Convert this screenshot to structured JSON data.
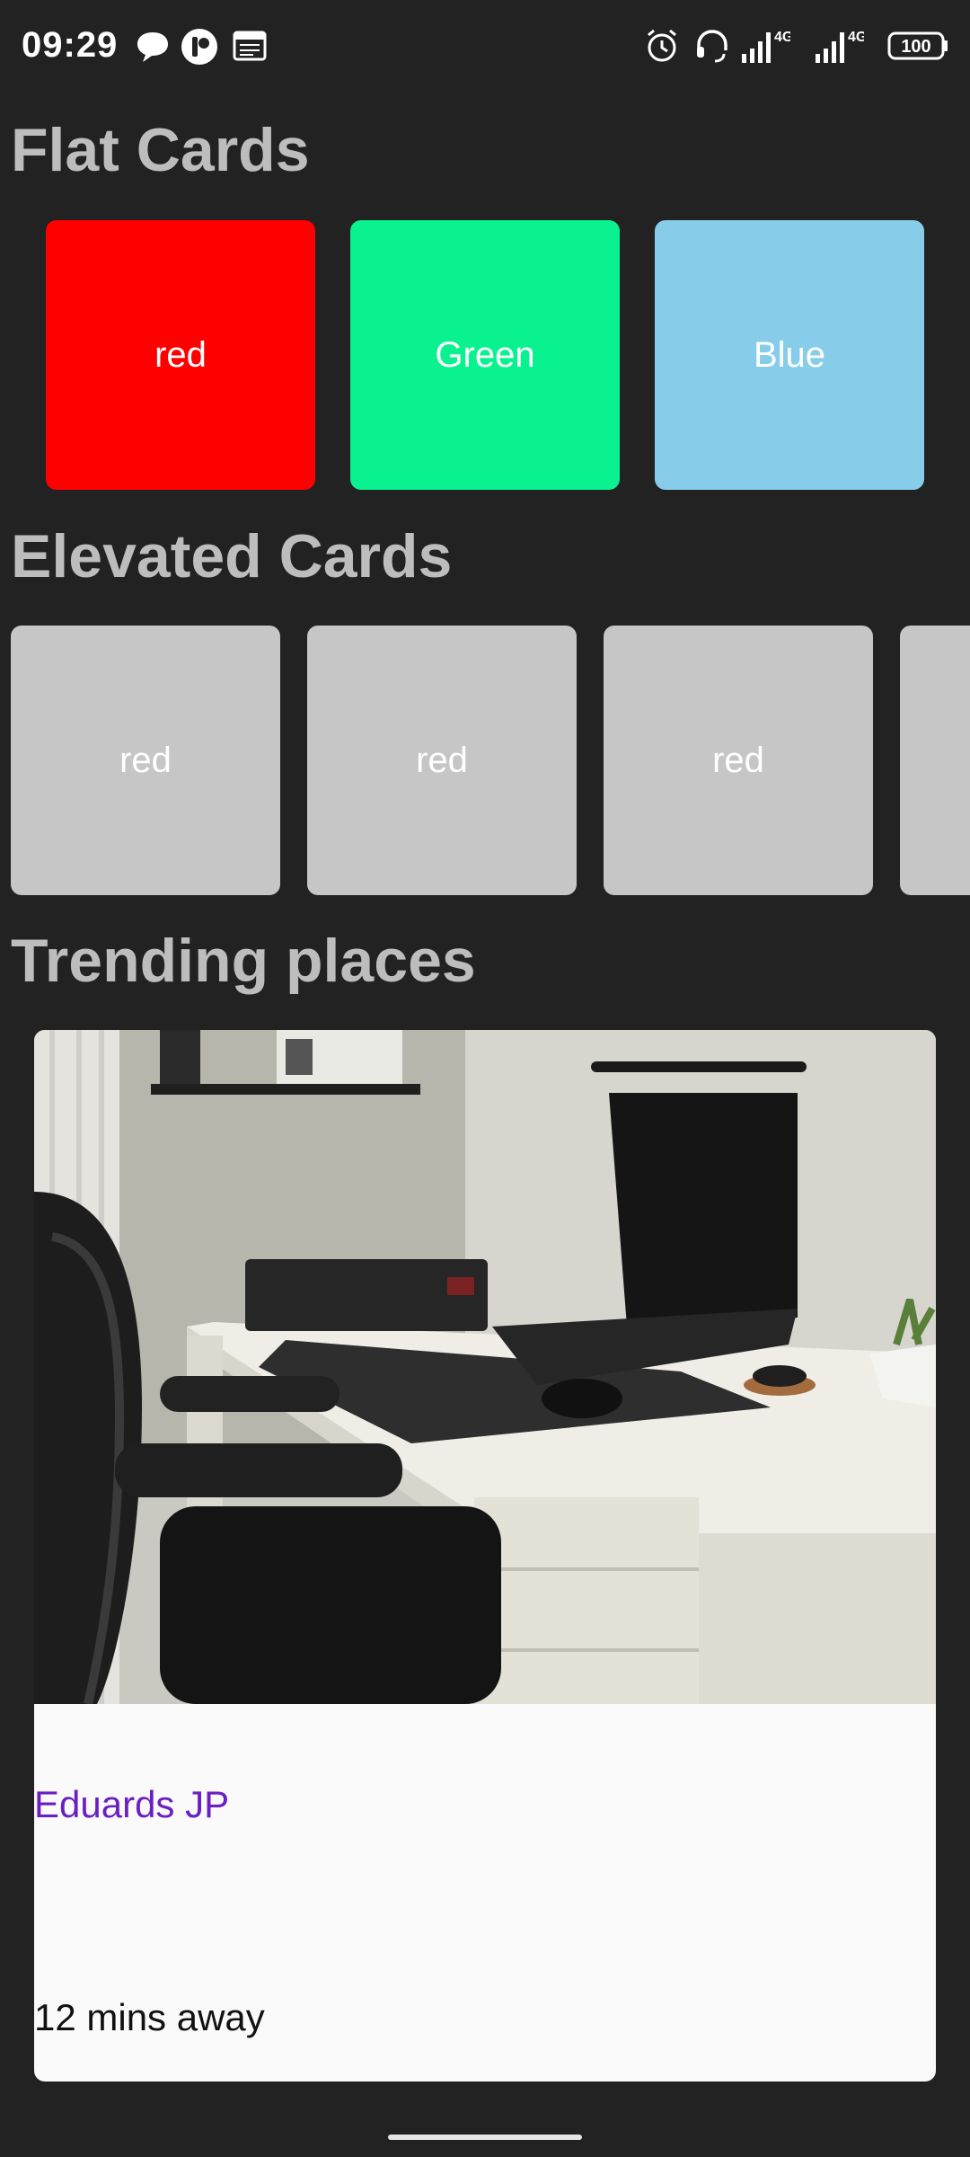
{
  "status_bar": {
    "time": "09:29",
    "icons_left": [
      "chat-bubble-icon",
      "app-badge-icon",
      "calendar-icon"
    ],
    "icons_right": [
      "alarm-icon",
      "headset-icon",
      "signal-4g-icon",
      "signal-4g-icon",
      "battery-icon"
    ],
    "network_1": "4G",
    "network_2": "4G",
    "battery": "100"
  },
  "sections": {
    "flat": "Flat Cards",
    "elevated": "Elevated Cards",
    "trending": "Trending places"
  },
  "flat_cards": [
    {
      "label": "red",
      "color": "#ff0000"
    },
    {
      "label": "Green",
      "color": "#0af28f"
    },
    {
      "label": "Blue",
      "color": "#87cdea"
    }
  ],
  "elevated_cards": [
    {
      "label": "red"
    },
    {
      "label": "red"
    },
    {
      "label": "red"
    }
  ],
  "trending_card": {
    "image": "desk-setup-photo",
    "author": "Eduards JP",
    "distance": "12 mins away"
  },
  "colors": {
    "background": "#222222",
    "title": "#bdbdbd",
    "elevated_card": "#c6c6c6",
    "author_link": "#6a1fc2"
  }
}
